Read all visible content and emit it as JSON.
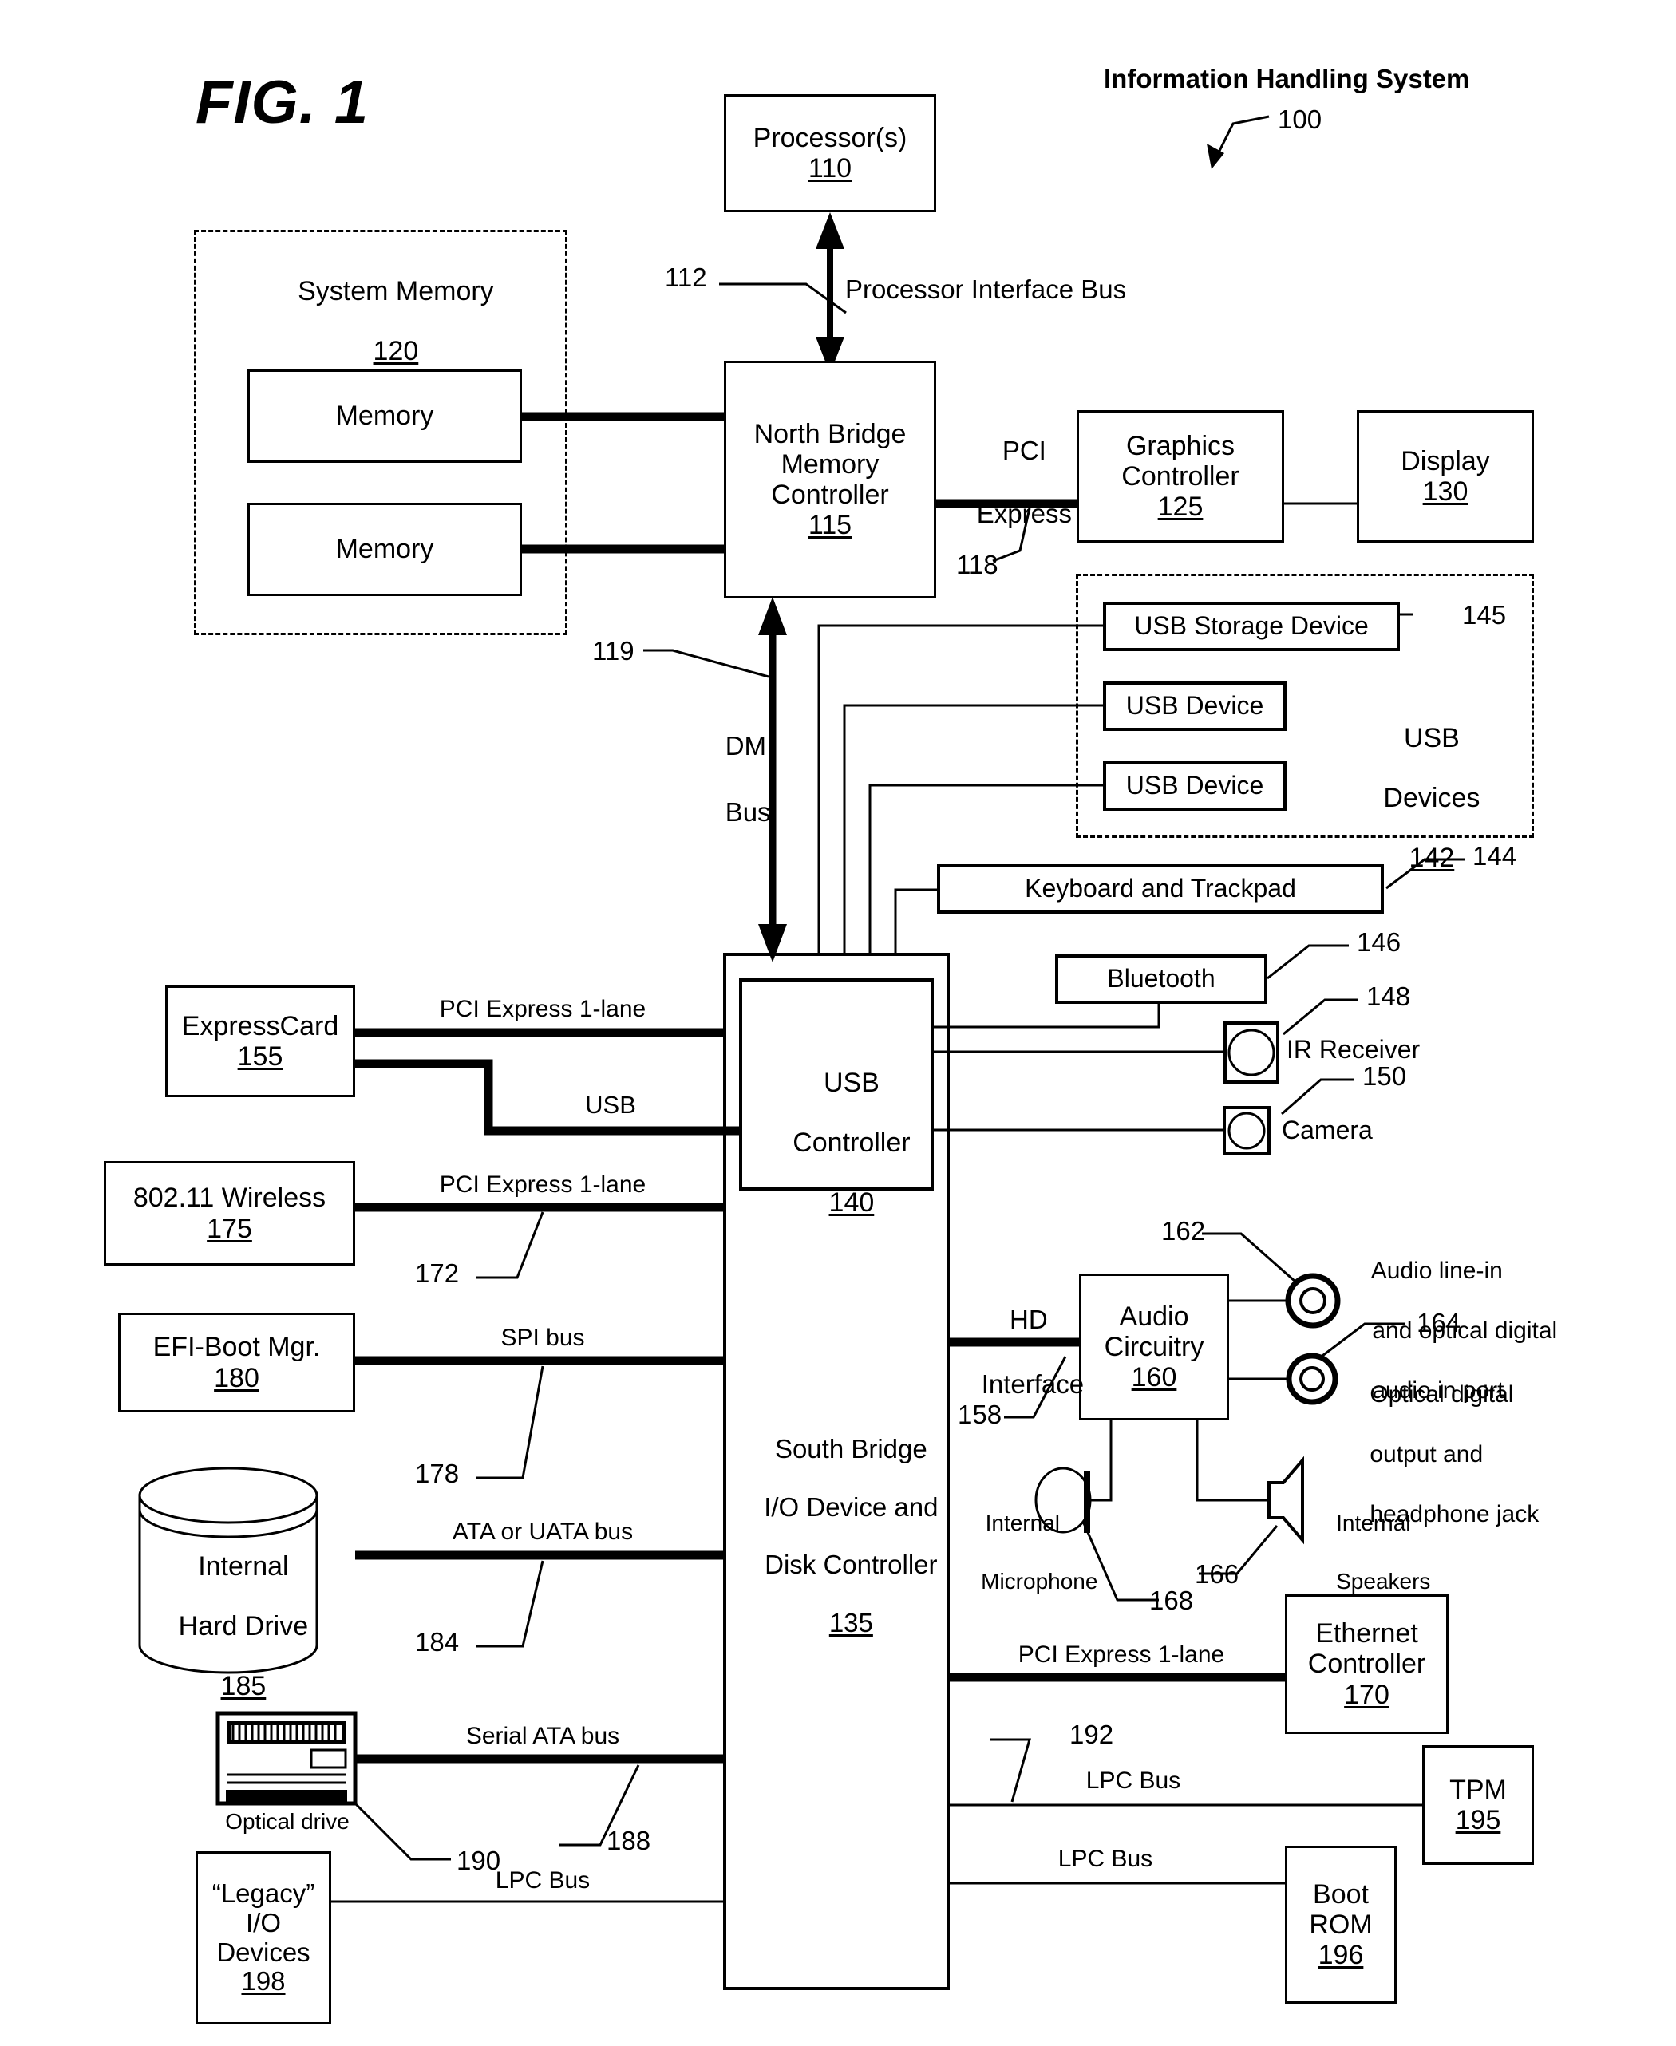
{
  "figure": {
    "title": "FIG. 1",
    "system_title": "Information Handling System",
    "system_ref": "100"
  },
  "blocks": {
    "processor": {
      "name": "Processor(s)",
      "ref": "110"
    },
    "north_bridge": {
      "line1": "North Bridge",
      "line2": "Memory",
      "line3": "Controller",
      "ref": "115"
    },
    "system_memory": {
      "name": "System Memory",
      "ref": "120"
    },
    "memory_1": {
      "name": "Memory"
    },
    "memory_2": {
      "name": "Memory"
    },
    "graphics": {
      "line1": "Graphics",
      "line2": "Controller",
      "ref": "125"
    },
    "display": {
      "name": "Display",
      "ref": "130"
    },
    "south_bridge": {
      "line1": "South Bridge",
      "line2": "I/O Device and",
      "line3": "Disk Controller",
      "ref": "135"
    },
    "usb_controller": {
      "line1": "USB",
      "line2": "Controller",
      "ref": "140"
    },
    "usb_devices_group": {
      "line1": "USB",
      "line2": "Devices",
      "ref": "142"
    },
    "usb_storage": {
      "name": "USB Storage Device",
      "ref": "145"
    },
    "usb_device_1": {
      "name": "USB Device"
    },
    "usb_device_2": {
      "name": "USB Device"
    },
    "keyboard": {
      "name": "Keyboard and Trackpad",
      "ref": "144"
    },
    "bluetooth": {
      "name": "Bluetooth",
      "ref": "146"
    },
    "ir_receiver": {
      "name": "IR Receiver",
      "ref": "148"
    },
    "camera": {
      "name": "Camera",
      "ref": "150"
    },
    "expresscard": {
      "name": "ExpressCard",
      "ref": "155"
    },
    "wireless": {
      "name": "802.11 Wireless",
      "ref": "175"
    },
    "efi_boot": {
      "name": "EFI-Boot Mgr.",
      "ref": "180"
    },
    "hard_drive": {
      "line1": "Internal",
      "line2": "Hard Drive",
      "ref": "185"
    },
    "optical_drive": {
      "name": "Optical drive",
      "ref": "190"
    },
    "legacy_io": {
      "line1": "“Legacy”",
      "line2": "I/O",
      "line3": "Devices",
      "ref": "198"
    },
    "audio": {
      "line1": "Audio",
      "line2": "Circuitry",
      "ref": "160"
    },
    "audio_line_in": {
      "line1": "Audio line-in",
      "line2": "and optical digital",
      "line3": "audio in port",
      "ref": "162"
    },
    "optical_out": {
      "line1": "Optical digital",
      "line2": "output and",
      "line3": "headphone jack",
      "ref": "164"
    },
    "internal_speakers": {
      "line1": "Internal",
      "line2": "Speakers",
      "ref": "166"
    },
    "internal_mic": {
      "line1": "Internal",
      "line2": "Microphone",
      "ref": "168"
    },
    "ethernet": {
      "line1": "Ethernet",
      "line2": "Controller",
      "ref": "170"
    },
    "tpm": {
      "name": "TPM",
      "ref": "195"
    },
    "boot_rom": {
      "line1": "Boot",
      "line2": "ROM",
      "ref": "196"
    }
  },
  "buses": {
    "processor_interface": {
      "label": "Processor Interface Bus",
      "ref": "112"
    },
    "pci_express_gfx": {
      "line1": "PCI",
      "line2": "Express",
      "ref": "118"
    },
    "dmi": {
      "line1": "DMI",
      "line2": "Bus",
      "ref": "119"
    },
    "expresscard_pcie": {
      "label": "PCI Express 1-lane"
    },
    "expresscard_usb": {
      "label": "USB"
    },
    "wireless_pcie": {
      "label": "PCI Express 1-lane",
      "ref": "172"
    },
    "spi": {
      "label": "SPI bus",
      "ref": "178"
    },
    "ata": {
      "label": "ATA or UATA bus",
      "ref": "184"
    },
    "sata": {
      "label": "Serial ATA bus",
      "ref": "188"
    },
    "legacy_lpc": {
      "label": "LPC Bus"
    },
    "hd_interface": {
      "line1": "HD",
      "line2": "Interface",
      "ref": "158"
    },
    "ethernet_pcie": {
      "label": "PCI Express 1-lane"
    },
    "tpm_lpc": {
      "label": "LPC Bus",
      "ref": "192"
    },
    "bootrom_lpc": {
      "label": "LPC Bus"
    }
  }
}
